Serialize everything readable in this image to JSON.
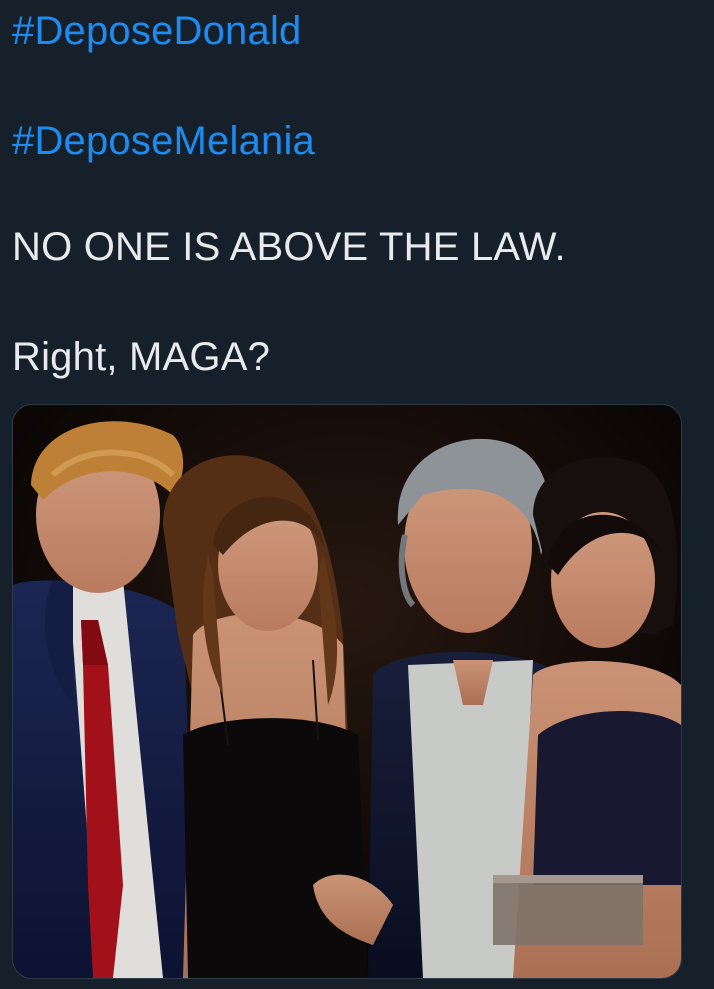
{
  "tweet": {
    "hashtags": [
      "#DeposeDonald",
      "#DeposeMelania"
    ],
    "lines": [
      "NO ONE IS ABOVE THE LAW.",
      "Right, MAGA?"
    ]
  },
  "media": {
    "type": "photo",
    "subjects": 4
  },
  "colors": {
    "background": "#16202b",
    "link": "#1d8bf0",
    "text": "#e8eaed"
  }
}
